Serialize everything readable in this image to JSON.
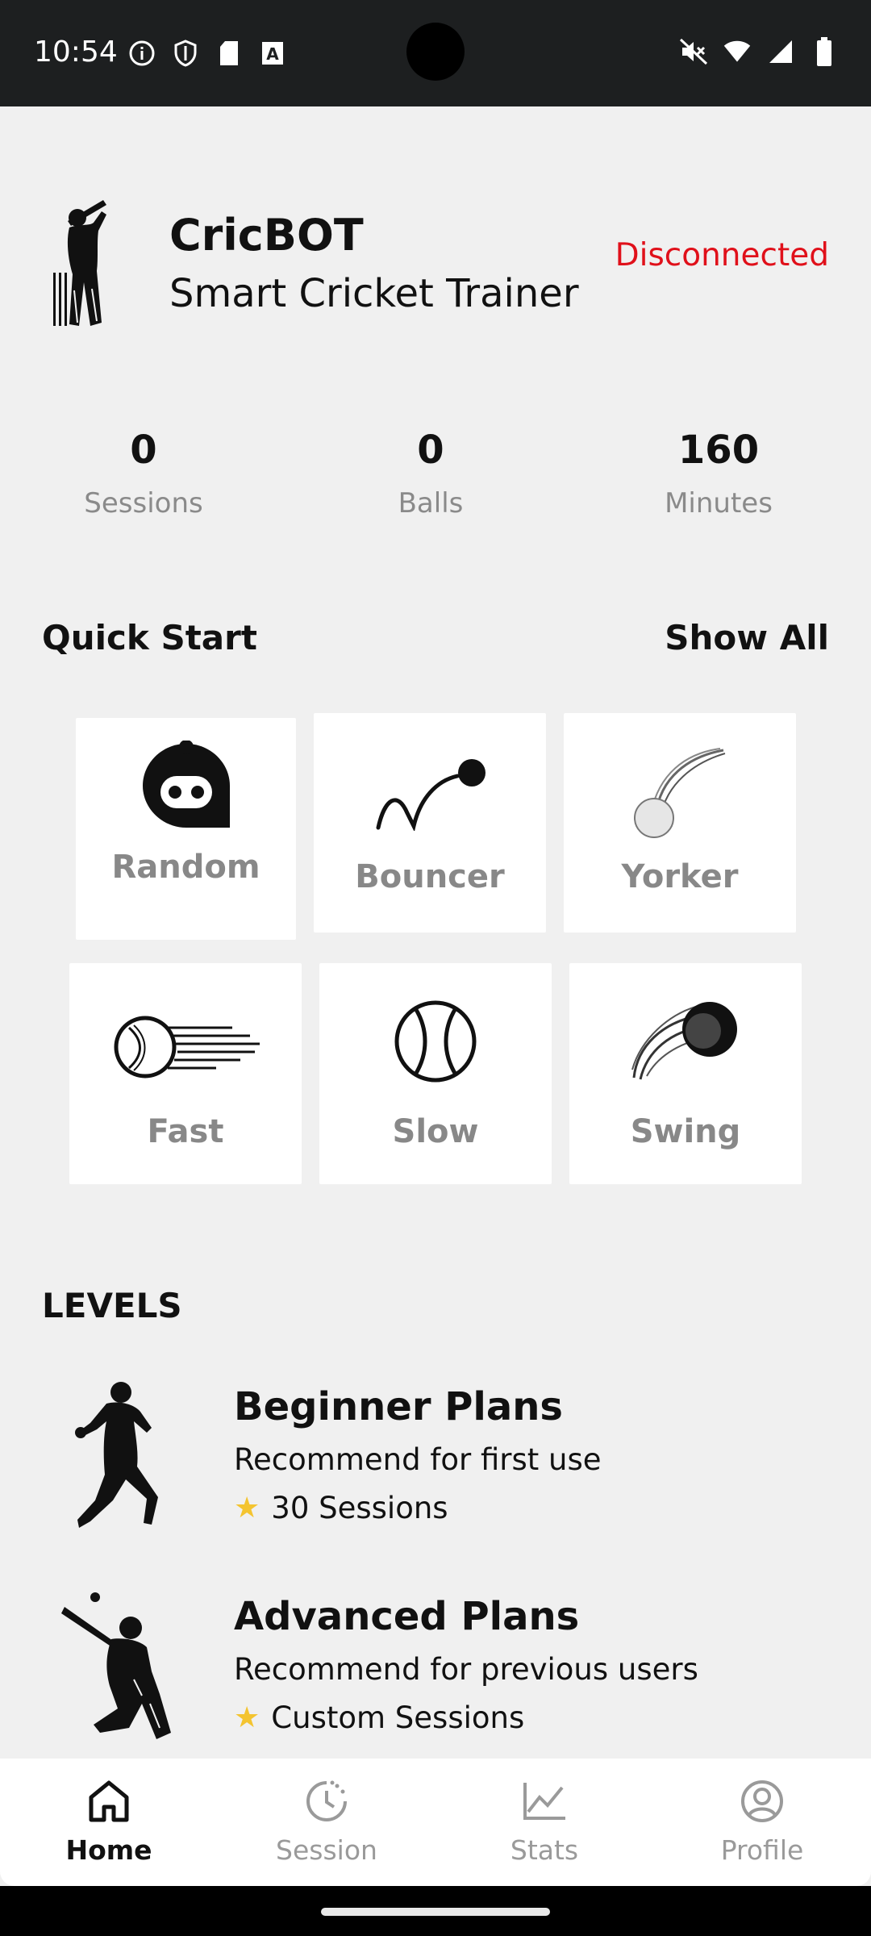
{
  "status_bar": {
    "time": "10:54",
    "left_icons": [
      "info-icon",
      "shield-icon",
      "sd-card-icon",
      "font-icon"
    ],
    "right_icons": [
      "mute-icon",
      "wifi-icon",
      "signal-icon",
      "battery-icon"
    ]
  },
  "header": {
    "title": "CricBOT",
    "subtitle": "Smart Cricket Trainer",
    "connection_status": "Disconnected",
    "status_color": "#e0101a"
  },
  "stats": [
    {
      "value": "0",
      "label": "Sessions"
    },
    {
      "value": "0",
      "label": "Balls"
    },
    {
      "value": "160",
      "label": "Minutes"
    }
  ],
  "quick_start": {
    "title": "Quick Start",
    "show_all": "Show All",
    "tiles": [
      {
        "label": "Random",
        "icon": "robot-icon"
      },
      {
        "label": "Bouncer",
        "icon": "bouncer-icon"
      },
      {
        "label": "Yorker",
        "icon": "yorker-icon"
      },
      {
        "label": "Fast",
        "icon": "fast-ball-icon"
      },
      {
        "label": "Slow",
        "icon": "slow-ball-icon"
      },
      {
        "label": "Swing",
        "icon": "swing-ball-icon"
      }
    ]
  },
  "levels": {
    "title": "LEVELS",
    "plans": [
      {
        "title": "Beginner Plans",
        "description": "Recommend for first use",
        "meta": "30 Sessions",
        "icon": "bowler-icon"
      },
      {
        "title": "Advanced Plans",
        "description": "Recommend for previous users",
        "meta": "Custom Sessions",
        "icon": "batsman-icon"
      }
    ]
  },
  "bottom_nav": [
    {
      "label": "Home",
      "icon": "home-icon",
      "active": true
    },
    {
      "label": "Session",
      "icon": "session-icon",
      "active": false
    },
    {
      "label": "Stats",
      "icon": "stats-icon",
      "active": false
    },
    {
      "label": "Profile",
      "icon": "profile-icon",
      "active": false
    }
  ]
}
